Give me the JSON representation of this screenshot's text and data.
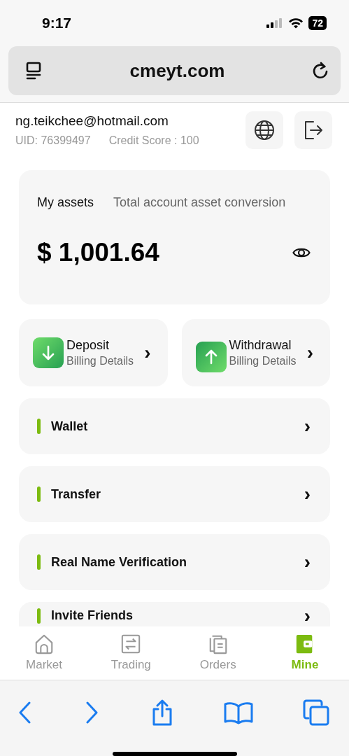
{
  "status_bar": {
    "time": "9:17",
    "battery": "72"
  },
  "browser": {
    "url": "cmeyt.com"
  },
  "profile": {
    "email": "ng.teikchee@hotmail.com",
    "uid": "UID: 76399497",
    "credit": "Credit Score : 100"
  },
  "assets": {
    "tabs": [
      {
        "label": "My assets",
        "selected": true
      },
      {
        "label": "Total account asset conversion",
        "selected": false
      }
    ],
    "amount": "$ 1,001.64"
  },
  "actions": [
    {
      "kind": "deposit",
      "title": "Deposit",
      "subtitle": "Billing Details",
      "chevron": "›"
    },
    {
      "kind": "withdrawal",
      "title": "Withdrawal",
      "subtitle": "Billing Details",
      "chevron": "›"
    }
  ],
  "menu": [
    {
      "label": "Wallet",
      "chevron": "›"
    },
    {
      "label": "Transfer",
      "chevron": "›"
    },
    {
      "label": "Real Name Verification",
      "chevron": "›"
    },
    {
      "label": "Invite Friends",
      "chevron": "›"
    }
  ],
  "tabbar": [
    {
      "kind": "market",
      "label": "Market",
      "selected": false
    },
    {
      "kind": "trading",
      "label": "Trading",
      "selected": false
    },
    {
      "kind": "orders",
      "label": "Orders",
      "selected": false
    },
    {
      "kind": "mine",
      "label": "Mine",
      "selected": true
    }
  ]
}
